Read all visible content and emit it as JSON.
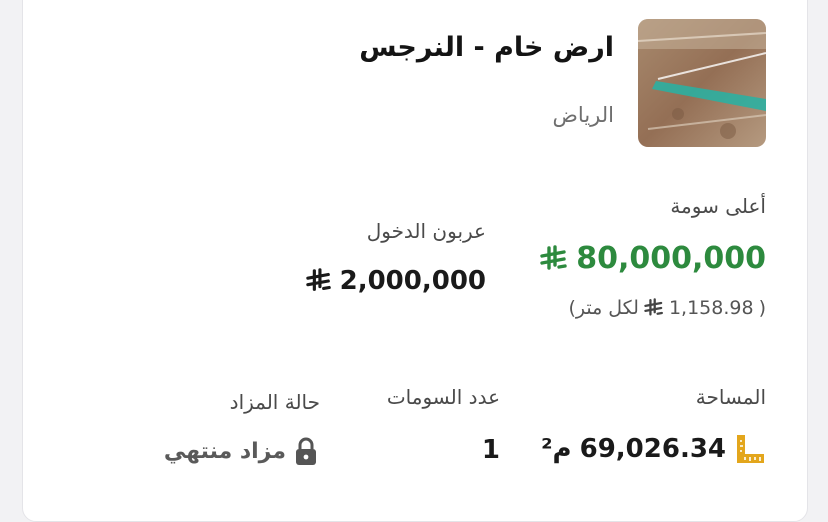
{
  "listing": {
    "title": "ارض خام - النرجس",
    "city": "الرياض",
    "image_label": "land-photo"
  },
  "highest_bid": {
    "label": "أعلى سومة",
    "value": "80,000,000",
    "per_meter_open": "(",
    "per_meter_value": "1,158.98",
    "per_meter_suffix": "لكل متر)"
  },
  "deposit": {
    "label": "عربون الدخول",
    "value": "2,000,000"
  },
  "area": {
    "label": "المساحة",
    "value": "69,026.34",
    "unit": "م²"
  },
  "bids_count": {
    "label": "عدد السومات",
    "value": "1"
  },
  "auction_status": {
    "label": "حالة المزاد",
    "value": "مزاد منتهي"
  },
  "colors": {
    "accent_green": "#2d8a3e",
    "ruler_yellow": "#e3a61c",
    "text_dark": "#1a1a1a"
  },
  "icons": {
    "currency": "saudi-riyal-icon",
    "area": "ruler-icon",
    "status": "lock-icon"
  }
}
